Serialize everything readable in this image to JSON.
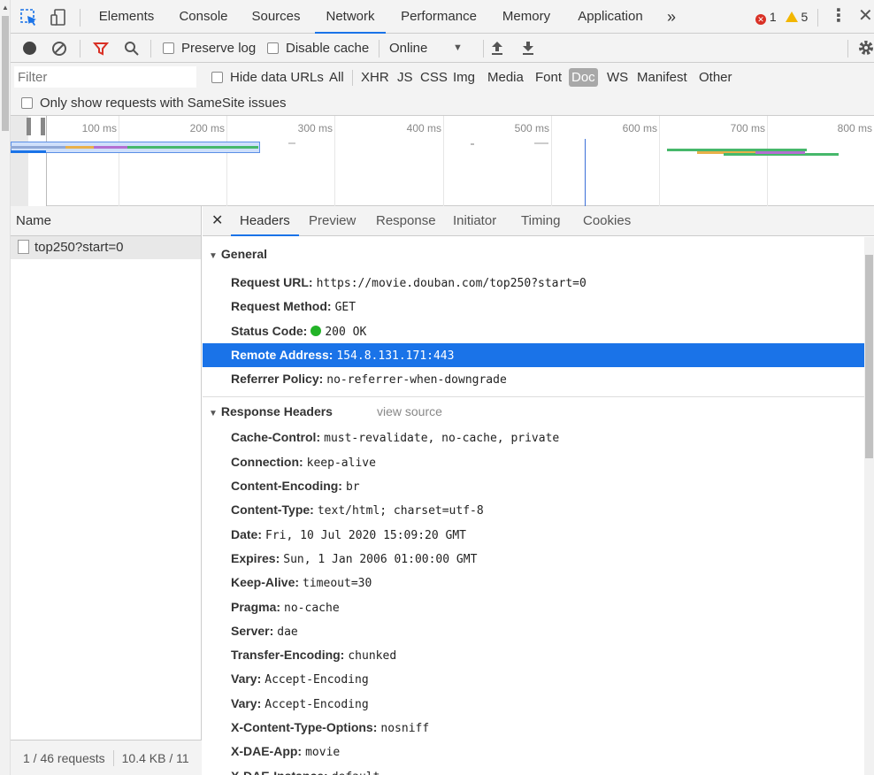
{
  "tabs": [
    {
      "label": "Elements",
      "active": false
    },
    {
      "label": "Console",
      "active": false
    },
    {
      "label": "Sources",
      "active": false
    },
    {
      "label": "Network",
      "active": true
    },
    {
      "label": "Performance",
      "active": false
    },
    {
      "label": "Memory",
      "active": false
    },
    {
      "label": "Application",
      "active": false
    }
  ],
  "more_tabs": "»",
  "errors": {
    "error_count": "1",
    "warning_count": "5"
  },
  "toolbar": {
    "preserve_log": "Preserve log",
    "disable_cache": "Disable cache",
    "throttle": "Online"
  },
  "filter": {
    "placeholder": "Filter",
    "hide_data_urls": "Hide data URLs",
    "types": [
      "All",
      "XHR",
      "JS",
      "CSS",
      "Img",
      "Media",
      "Font",
      "Doc",
      "WS",
      "Manifest",
      "Other"
    ],
    "active_type": "Doc",
    "samesite": "Only show requests with SameSite issues"
  },
  "overview": {
    "ticks": [
      "100 ms",
      "200 ms",
      "300 ms",
      "400 ms",
      "500 ms",
      "600 ms",
      "700 ms",
      "800 ms"
    ]
  },
  "requests": {
    "header": "Name",
    "items": [
      "top250?start=0"
    ],
    "status_requests": "1 / 46 requests",
    "status_size": "10.4 KB / 11"
  },
  "detail_tabs": [
    "Headers",
    "Preview",
    "Response",
    "Initiator",
    "Timing",
    "Cookies"
  ],
  "general": {
    "title": "General",
    "request_url_k": "Request URL:",
    "request_url_v": "https://movie.douban.com/top250?start=0",
    "method_k": "Request Method:",
    "method_v": "GET",
    "status_k": "Status Code:",
    "status_v": "200 OK",
    "remote_k": "Remote Address:",
    "remote_v": "154.8.131.171:443",
    "referrer_k": "Referrer Policy:",
    "referrer_v": "no-referrer-when-downgrade"
  },
  "response_headers": {
    "title": "Response Headers",
    "view_source": "view source",
    "rows": [
      {
        "k": "Cache-Control:",
        "v": "must-revalidate, no-cache, private"
      },
      {
        "k": "Connection:",
        "v": "keep-alive"
      },
      {
        "k": "Content-Encoding:",
        "v": "br"
      },
      {
        "k": "Content-Type:",
        "v": "text/html; charset=utf-8"
      },
      {
        "k": "Date:",
        "v": "Fri, 10 Jul 2020 15:09:20 GMT"
      },
      {
        "k": "Expires:",
        "v": "Sun, 1 Jan 2006 01:00:00 GMT"
      },
      {
        "k": "Keep-Alive:",
        "v": "timeout=30"
      },
      {
        "k": "Pragma:",
        "v": "no-cache"
      },
      {
        "k": "Server:",
        "v": "dae"
      },
      {
        "k": "Transfer-Encoding:",
        "v": "chunked"
      },
      {
        "k": "Vary:",
        "v": "Accept-Encoding"
      },
      {
        "k": "Vary:",
        "v": "Accept-Encoding"
      },
      {
        "k": "X-Content-Type-Options:",
        "v": "nosniff"
      },
      {
        "k": "X-DAE-App:",
        "v": "movie"
      },
      {
        "k": "X-DAE-Instance:",
        "v": "default"
      }
    ]
  },
  "colors": {
    "accent": "#1a73e8",
    "status_green": "#22b327",
    "error_red": "#d93025",
    "warning_yellow": "#f2b600",
    "record_red": "#d93025"
  }
}
